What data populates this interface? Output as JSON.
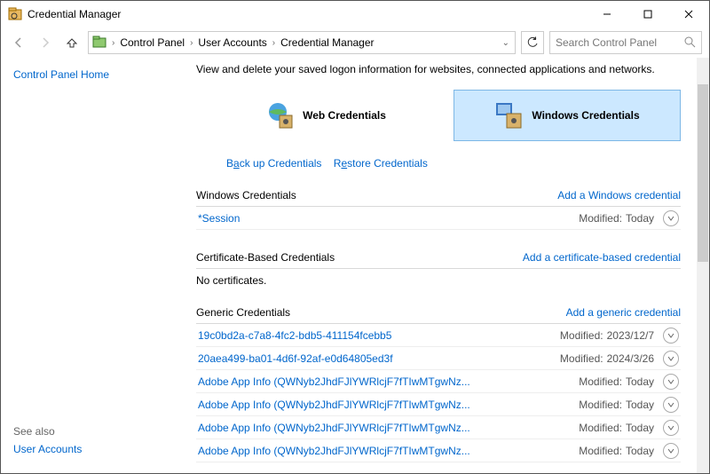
{
  "titlebar": {
    "title": "Credential Manager"
  },
  "breadcrumb": {
    "a": "Control Panel",
    "b": "User Accounts",
    "c": "Credential Manager"
  },
  "search": {
    "placeholder": "Search Control Panel"
  },
  "sidebar": {
    "home": "Control Panel Home",
    "seealso": "See also",
    "useraccounts": "User Accounts"
  },
  "intro": "View and delete your saved logon information for websites, connected applications and networks.",
  "tiles": {
    "web": "Web Credentials",
    "windows": "Windows Credentials"
  },
  "links": {
    "backup_pre": "B",
    "backup_u": "a",
    "backup_post": "ck up Credentials",
    "restore_pre": "R",
    "restore_u": "e",
    "restore_post": "store Credentials"
  },
  "sections": {
    "win": {
      "title": "Windows Credentials",
      "add": "Add a Windows credential"
    },
    "cert": {
      "title": "Certificate-Based Credentials",
      "add": "Add a certificate-based credential",
      "empty": "No certificates."
    },
    "generic": {
      "title": "Generic Credentials",
      "add": "Add a generic credential"
    }
  },
  "modlabel": "Modified:",
  "rows": {
    "win0": {
      "name": "*Session",
      "mod": "Today"
    },
    "g0": {
      "name": "19c0bd2a-c7a8-4fc2-bdb5-411154fcebb5",
      "mod": "2023/12/7"
    },
    "g1": {
      "name": "20aea499-ba01-4d6f-92af-e0d64805ed3f",
      "mod": "2024/3/26"
    },
    "g2": {
      "name": "Adobe App Info (QWNyb2JhdFJlYWRlcjF7fTIwMTgwNz...",
      "mod": "Today"
    },
    "g3": {
      "name": "Adobe App Info (QWNyb2JhdFJlYWRlcjF7fTIwMTgwNz...",
      "mod": "Today"
    },
    "g4": {
      "name": "Adobe App Info (QWNyb2JhdFJlYWRlcjF7fTIwMTgwNz...",
      "mod": "Today"
    },
    "g5": {
      "name": "Adobe App Info (QWNyb2JhdFJlYWRlcjF7fTIwMTgwNz...",
      "mod": "Today"
    }
  }
}
